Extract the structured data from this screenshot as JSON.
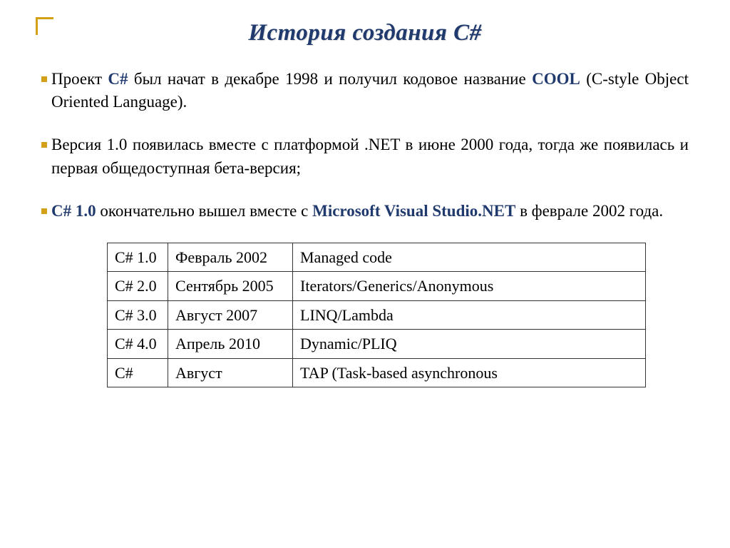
{
  "title": "История создания C#",
  "bullets": [
    {
      "pre": "Проект ",
      "hl1": "C#",
      "mid1": " был начат в декабре 1998 и получил кодовое название ",
      "hl2": "COOL",
      "post": " (C-style Object Oriented Language)."
    },
    {
      "pre": "Версия 1.0 появилась вместе с платформой .NET в июне 2000 года, тогда же появилась и первая общедоступная бета-версия;",
      "hl1": "",
      "mid1": "",
      "hl2": "",
      "post": ""
    },
    {
      "pre": "",
      "hl1": "C# 1.0",
      "mid1": " окончательно вышел вместе с ",
      "hl2": "Microsoft Visual Studio.NET",
      "post": " в феврале 2002 года."
    }
  ],
  "table": [
    {
      "ver": "C# 1.0",
      "date": "Февраль 2002",
      "feat": "Managed code"
    },
    {
      "ver": "C# 2.0",
      "date": "Сентябрь 2005",
      "feat": "Iterators/Generics/Anonymous"
    },
    {
      "ver": "C# 3.0",
      "date": "Август 2007",
      "feat": "LINQ/Lambda"
    },
    {
      "ver": "C# 4.0",
      "date": "Апрель 2010",
      "feat": "Dynamic/PLIQ"
    },
    {
      "ver": "C#",
      "date": "Август",
      "feat": "TAP (Task-based asynchronous"
    }
  ]
}
